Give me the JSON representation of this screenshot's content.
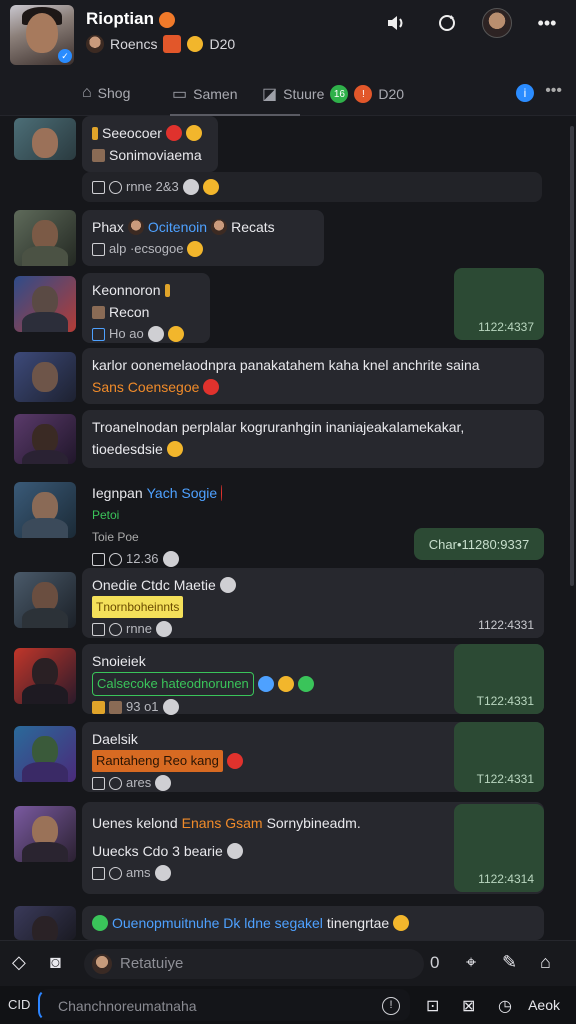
{
  "header": {
    "title": "Rioptian",
    "subtitle": "Roencs",
    "subtitle_count": "D20",
    "icons": [
      "speaker-icon",
      "refresh-icon",
      "profile-avatar",
      "more-icon"
    ]
  },
  "tabs": [
    {
      "label": "Shog",
      "icon": "home-icon"
    },
    {
      "label": "Samen",
      "icon": "chat-icon"
    },
    {
      "label": "Stuure",
      "icon": "image-icon",
      "badge": "16",
      "count": "D20"
    }
  ],
  "messages": [
    {
      "line1": "Seeocoer",
      "line2": "Sonimoviaema",
      "meta": "rnne 2&3"
    },
    {
      "line1": "Phax",
      "line1_blue": "Ocitenoin",
      "line1_tail": "Recats",
      "meta": "alp ·ecsogoe"
    },
    {
      "line1": "Keonnoron",
      "line2": "Recon",
      "meta": "Ho ao"
    },
    {
      "line1": "karlor oonemelaodnpra panakatahem kaha knel anchrite saina",
      "line2_orange": "Sans Coensegoe"
    },
    {
      "line1": "Troanelnodan perplalar kogruranhgin inaniajeakalamekakar,",
      "line2": "tioedesdsie"
    },
    {
      "line1": "Iegnpan",
      "line1_blue": "Yach Sogie",
      "line2_green": "Petoi",
      "line3": "Toie Poe",
      "meta": "12.36"
    },
    {
      "line1": "Onedie Ctdc Maetie",
      "line2_yellow": "Tnornboheinnts",
      "meta": "rnne"
    },
    {
      "line1": "Snoieiek",
      "line2_greenbox": "Calsecoke hateodnorunen",
      "meta": "93 o1"
    },
    {
      "line1": "Daelsik",
      "line2_orangebox": "Rantaheng Reo kang",
      "meta": "ares"
    },
    {
      "line1": "Uenes kelond",
      "line1_orange": "Enans Gsam",
      "line1_tail": "Sornybineadm.",
      "line2": "Uuecks Cdo 3 bearie",
      "meta": "ams"
    },
    {
      "line1": "Ouenopmuitnuhe Dk ldne segakel",
      "line1_tail": "tinengrtae"
    }
  ],
  "green_bubbles": [
    {
      "time": "1122:4337"
    },
    {
      "time": "Char•11280:9337",
      "pill": true
    },
    {
      "time": "1122:4331"
    },
    {
      "time": "T122:4331"
    },
    {
      "time": "T122:4331"
    },
    {
      "time": "1122:4314"
    }
  ],
  "compose": {
    "placeholder": "Retatuiye",
    "count": "0"
  },
  "inputbar": {
    "label": "CID",
    "placeholder": "Chanchnoreumatnaha",
    "send_label": "Aeok"
  },
  "colors": {
    "background": "#16171b",
    "bubble": "#27282e",
    "green_bubble": "#2c4a34",
    "accent_blue": "#2b84ff"
  }
}
